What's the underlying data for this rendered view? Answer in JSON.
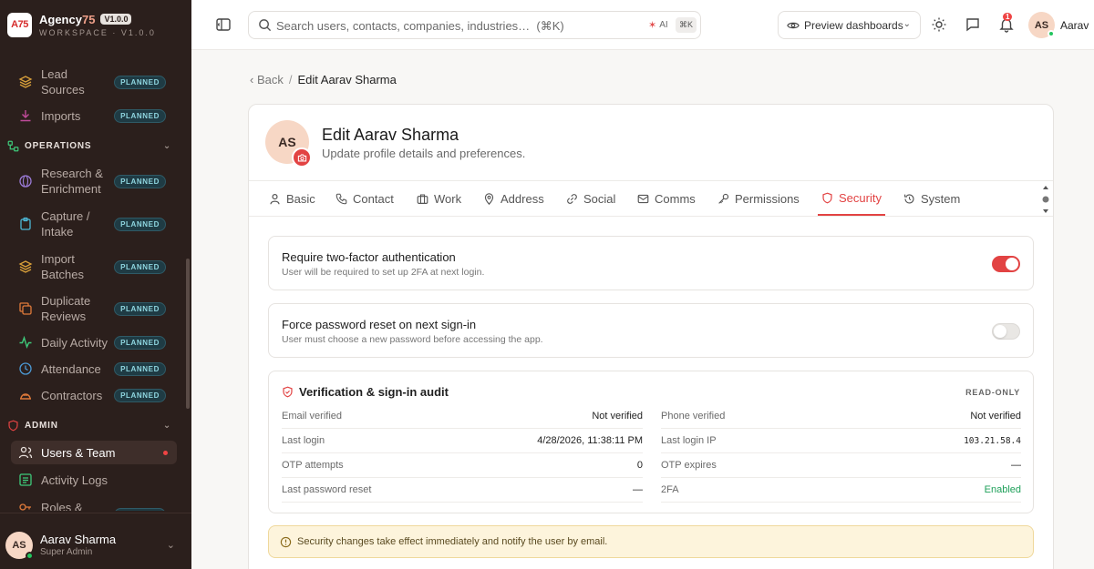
{
  "brand": {
    "logo_text": "A75",
    "name_main": "Agency",
    "name_accent": "75",
    "version_badge": "V1.0.0",
    "subtitle": "WORKSPACE · V1.0.0"
  },
  "sidebar": {
    "planned_label": "PLANNED",
    "items_top": [
      {
        "label": "Lead\nSources",
        "planned": true
      },
      {
        "label": "Imports",
        "planned": true
      }
    ],
    "operations": {
      "title": "OPERATIONS",
      "items": [
        {
          "label": "Research &\nEnrichment",
          "planned": true
        },
        {
          "label": "Capture /\nIntake",
          "planned": true
        },
        {
          "label": "Import\nBatches",
          "planned": true
        },
        {
          "label": "Duplicate\nReviews",
          "planned": true
        },
        {
          "label": "Daily Activity",
          "planned": true
        },
        {
          "label": "Attendance",
          "planned": true
        },
        {
          "label": "Contractors",
          "planned": true
        }
      ]
    },
    "admin": {
      "title": "ADMIN",
      "items": [
        {
          "label": "Users & Team",
          "active": true
        },
        {
          "label": "Activity Logs"
        },
        {
          "label": "Roles &",
          "planned": true
        }
      ]
    },
    "user": {
      "initials": "AS",
      "name": "Aarav Sharma",
      "role": "Super Admin"
    }
  },
  "topbar": {
    "search_placeholder": "Search users, contacts, companies, industries…  (⌘K)",
    "ai_label": "AI",
    "kbd": "⌘K",
    "preview_label": "Preview dashboards",
    "notification_count": "1",
    "user_initials": "AS",
    "user_name": "Aarav"
  },
  "breadcrumb": {
    "back": "Back",
    "separator": "/",
    "current": "Edit Aarav Sharma"
  },
  "profile": {
    "initials": "AS",
    "title": "Edit Aarav Sharma",
    "subtitle": "Update profile details and preferences."
  },
  "tabs": [
    {
      "label": "Basic",
      "icon": "user-icon"
    },
    {
      "label": "Contact",
      "icon": "phone-icon"
    },
    {
      "label": "Work",
      "icon": "briefcase-icon"
    },
    {
      "label": "Address",
      "icon": "map-pin-icon"
    },
    {
      "label": "Social",
      "icon": "link-icon"
    },
    {
      "label": "Comms",
      "icon": "mail-icon"
    },
    {
      "label": "Permissions",
      "icon": "key-icon"
    },
    {
      "label": "Security",
      "icon": "shield-icon",
      "active": true
    },
    {
      "label": "System",
      "icon": "history-icon"
    }
  ],
  "settings": {
    "two_factor": {
      "title": "Require two-factor authentication",
      "description": "User will be required to set up 2FA at next login.",
      "enabled": true
    },
    "force_reset": {
      "title": "Force password reset on next sign-in",
      "description": "User must choose a new password before accessing the app.",
      "enabled": false
    }
  },
  "audit": {
    "title": "Verification & sign-in audit",
    "badge": "READ-ONLY",
    "left": [
      {
        "key": "Email verified",
        "value": "Not verified"
      },
      {
        "key": "Last login",
        "value": "4/28/2026, 11:38:11 PM"
      },
      {
        "key": "OTP attempts",
        "value": "0"
      },
      {
        "key": "Last password reset",
        "value": "—"
      }
    ],
    "right": [
      {
        "key": "Phone verified",
        "value": "Not verified"
      },
      {
        "key": "Last login IP",
        "value": "103.21.58.4"
      },
      {
        "key": "OTP expires",
        "value": "—"
      },
      {
        "key": "2FA",
        "value": "Enabled"
      }
    ]
  },
  "notice": {
    "text": "Security changes take effect immediately and notify the user by email."
  },
  "colors": {
    "accent": "#e24343",
    "sidebar_bg": "#2b1f1c",
    "success": "#1fa05a",
    "planned_badge": "#8fd6e0"
  }
}
